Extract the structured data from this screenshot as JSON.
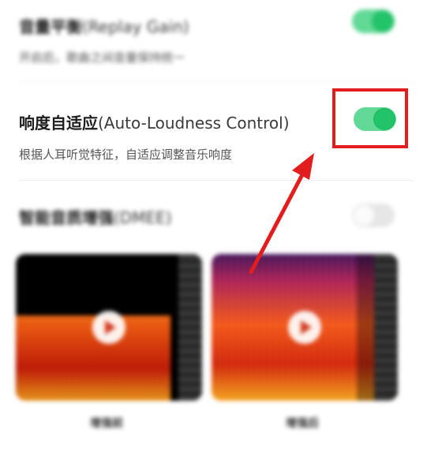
{
  "replay_gain": {
    "title_cn": "音量平衡",
    "title_en": "(Replay Gain)",
    "description": "开启后，歌曲之间音量保持统一",
    "enabled": true
  },
  "auto_loudness": {
    "title_cn": "响度自适应",
    "title_en": "(Auto-Loudness Control)",
    "description": "根据人耳听觉特征，自适应调整音乐响度",
    "enabled": true
  },
  "dmee": {
    "title_cn": "智能音质增强",
    "title_en": "(DMEE)",
    "enabled": false
  },
  "previews": [
    {
      "caption": "增强前"
    },
    {
      "caption": "增强后"
    }
  ],
  "colors": {
    "toggle_on": "#23c36a",
    "highlight": "#e21d1d"
  }
}
